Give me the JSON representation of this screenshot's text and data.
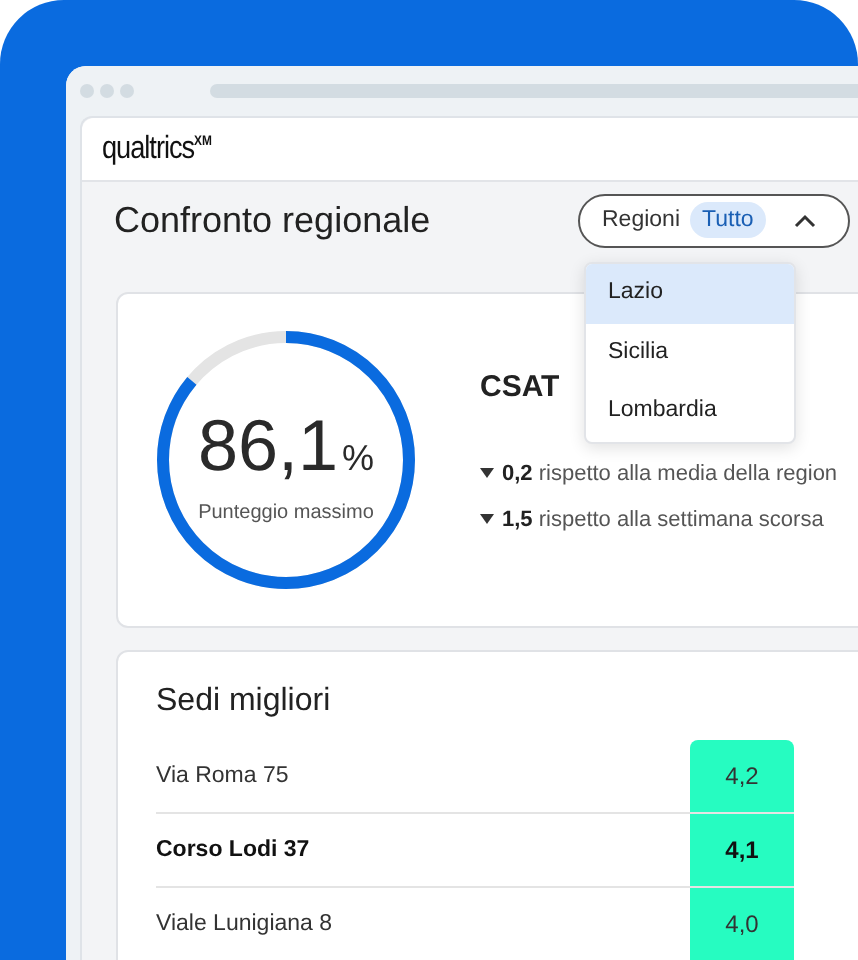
{
  "logo": "qualtrics$^{XM}$",
  "page_title": "Confronto regionale",
  "filter": {
    "label": "Regioni",
    "value": "Tutto",
    "expanded": true
  },
  "dropdown": {
    "options": [
      {
        "label": "Lazio",
        "selected": true
      },
      {
        "label": "Sicilia",
        "selected": false
      },
      {
        "label": "Lombardia",
        "selected": false
      }
    ]
  },
  "score_card": {
    "gauge": {
      "value": "86,1",
      "unit": "%",
      "caption": "Punteggio massimo"
    },
    "metric": "CSAT",
    "changes": [
      {
        "value": "0,2",
        "text": "rispetto alla media della region"
      },
      {
        "value": "1,5",
        "text": "rispetto alla settimana scorsa"
      }
    ]
  },
  "sites": {
    "title": "Sedi migliori",
    "rows": [
      {
        "name": "Via Roma 75",
        "score": "4,2",
        "highlighted": false
      },
      {
        "name": "Corso Lodi 37",
        "score": "4,1",
        "highlighted": true
      },
      {
        "name": "Viale Lunigiana 8",
        "score": "4,0",
        "highlighted": false
      }
    ]
  }
}
